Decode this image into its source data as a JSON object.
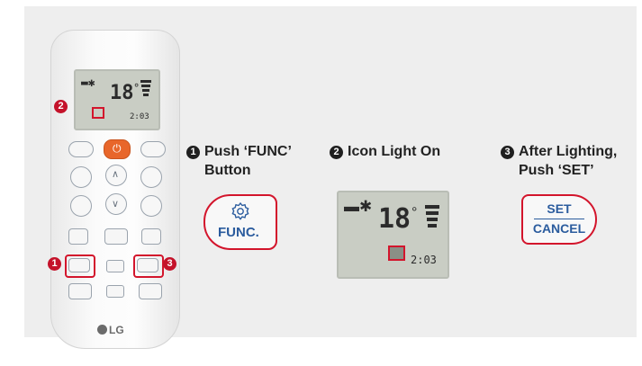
{
  "steps": [
    {
      "number": "1",
      "line1": "Push ‘FUNC’",
      "line2": "Button"
    },
    {
      "number": "2",
      "line1": "Icon Light On",
      "line2": ""
    },
    {
      "number": "3",
      "line1": "After Lighting,",
      "line2": "Push ‘SET’"
    }
  ],
  "func_button": {
    "label": "FUNC."
  },
  "set_button": {
    "top": "SET",
    "bottom": "CANCEL"
  },
  "lcd": {
    "temp": "18",
    "unit": "°",
    "time": "2:03"
  },
  "remote": {
    "brand": "LG",
    "badge_1": "1",
    "badge_2": "2",
    "badge_3": "3"
  },
  "colors": {
    "accent": "#d3152c",
    "power": "#e8662a",
    "lcd": "#c9cdc4"
  }
}
